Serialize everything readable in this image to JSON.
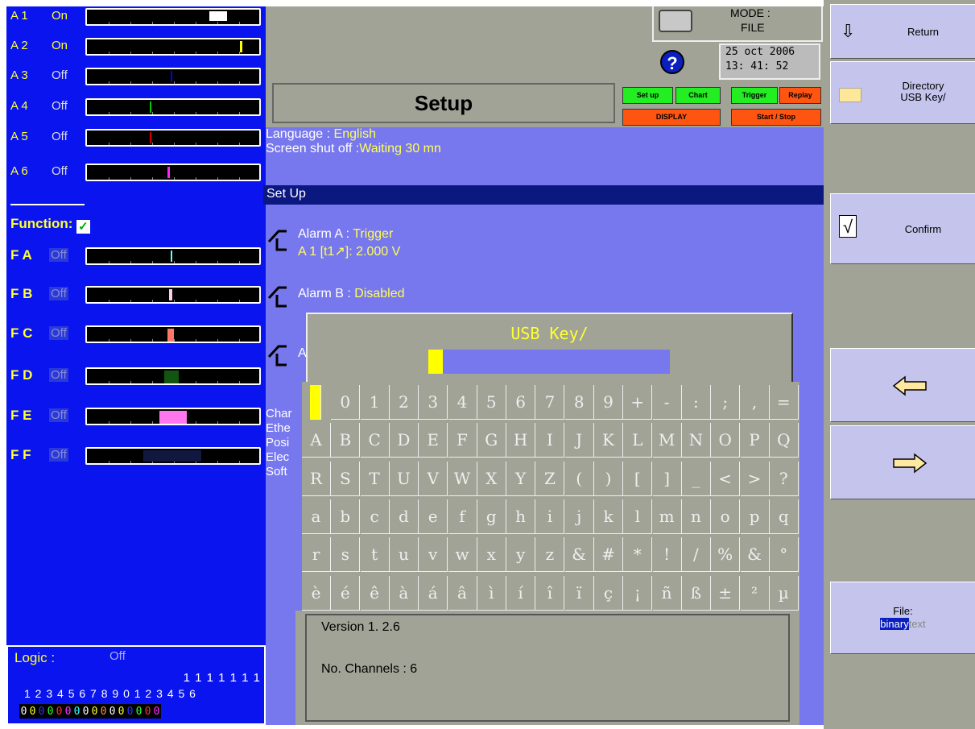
{
  "channels": [
    {
      "name": "A 1",
      "state": "On"
    },
    {
      "name": "A 2",
      "state": "On"
    },
    {
      "name": "A 3",
      "state": "Off"
    },
    {
      "name": "A 4",
      "state": "Off"
    },
    {
      "name": "A 5",
      "state": "Off"
    },
    {
      "name": "A 6",
      "state": "Off"
    }
  ],
  "function_label": "Function:",
  "functions": [
    {
      "name": "F A",
      "state": "Off"
    },
    {
      "name": "F B",
      "state": "Off"
    },
    {
      "name": "F C",
      "state": "Off"
    },
    {
      "name": "F D",
      "state": "Off"
    },
    {
      "name": "F E",
      "state": "Off"
    },
    {
      "name": "F F",
      "state": "Off"
    }
  ],
  "logic": {
    "label": "Logic :",
    "state": "Off",
    "tens_row": "1 1 1 1 1 1 1",
    "index_row": "1 2 3 4 5 6 7 8 9 0 1 2 3 4 5 6",
    "values": [
      "0",
      "0",
      "0",
      "0",
      "0",
      "0",
      "0",
      "0",
      "0",
      "0",
      "0",
      "0",
      "0",
      "0",
      "0",
      "0"
    ]
  },
  "header": {
    "mode_label": "MODE :",
    "mode_value": "FILE",
    "date": "25 oct 2006",
    "time": "13: 41: 52",
    "title": "Setup",
    "buttons": {
      "setup": "Set up",
      "chart": "Chart",
      "trigger": "Trigger",
      "replay": "Replay",
      "display": "DISPLAY",
      "startstop": "Start / Stop"
    }
  },
  "info": {
    "language_label": "Language : ",
    "language_value": "English",
    "shutoff_label": "Screen shut off :",
    "shutoff_value": "Waiting  30 mn"
  },
  "setup_section": {
    "title": "Set Up",
    "alarm_a_label": "Alarm A : ",
    "alarm_a_value": "Trigger",
    "alarm_a_detail": "A 1 [t1↗]:  2.000 V",
    "alarm_b_label": "Alarm B : ",
    "alarm_b_value": "Disabled",
    "alarm_c_partial": "A",
    "side_lines": [
      "Char",
      "Ethe",
      "Posi",
      "Elec",
      "Soft"
    ]
  },
  "keyboard": {
    "title": "USB Key/",
    "rows": [
      [
        "",
        "0",
        "1",
        "2",
        "3",
        "4",
        "5",
        "6",
        "7",
        "8",
        "9",
        "+",
        "-",
        ":",
        ";",
        ",",
        "="
      ],
      [
        "A",
        "B",
        "C",
        "D",
        "E",
        "F",
        "G",
        "H",
        "I",
        "J",
        "K",
        "L",
        "M",
        "N",
        "O",
        "P",
        "Q"
      ],
      [
        "R",
        "S",
        "T",
        "U",
        "V",
        "W",
        "X",
        "Y",
        "Z",
        "(",
        ")",
        "[",
        "]",
        "_",
        "<",
        ">",
        "?"
      ],
      [
        "a",
        "b",
        "c",
        "d",
        "e",
        "f",
        "g",
        "h",
        "i",
        "j",
        "k",
        "l",
        "m",
        "n",
        "o",
        "p",
        "q"
      ],
      [
        "r",
        "s",
        "t",
        "u",
        "v",
        "w",
        "x",
        "y",
        "z",
        "&",
        "#",
        "*",
        "!",
        "/",
        "%",
        "&",
        "°"
      ],
      [
        "è",
        "é",
        "ê",
        "à",
        "á",
        "â",
        "ì",
        "í",
        "î",
        "ï",
        "ç",
        "¡",
        "ñ",
        "ß",
        "±",
        "²",
        "µ"
      ]
    ]
  },
  "status": {
    "version": "Version 1. 2.6",
    "channels": "No. Channels : 6"
  },
  "sidebar": {
    "return": "Return",
    "directory": "Directory",
    "directory_sub": "USB Key/",
    "confirm": "Confirm",
    "file_label": "File:",
    "file_binary": "binary",
    "file_text": "text"
  },
  "colors": {
    "panel_blue": "#0a14ee",
    "center_blue": "#7878ee",
    "gray": "#a2a397",
    "yellow": "#ffff33",
    "green_btn": "#22ee22",
    "orange_btn": "#ff5511"
  }
}
